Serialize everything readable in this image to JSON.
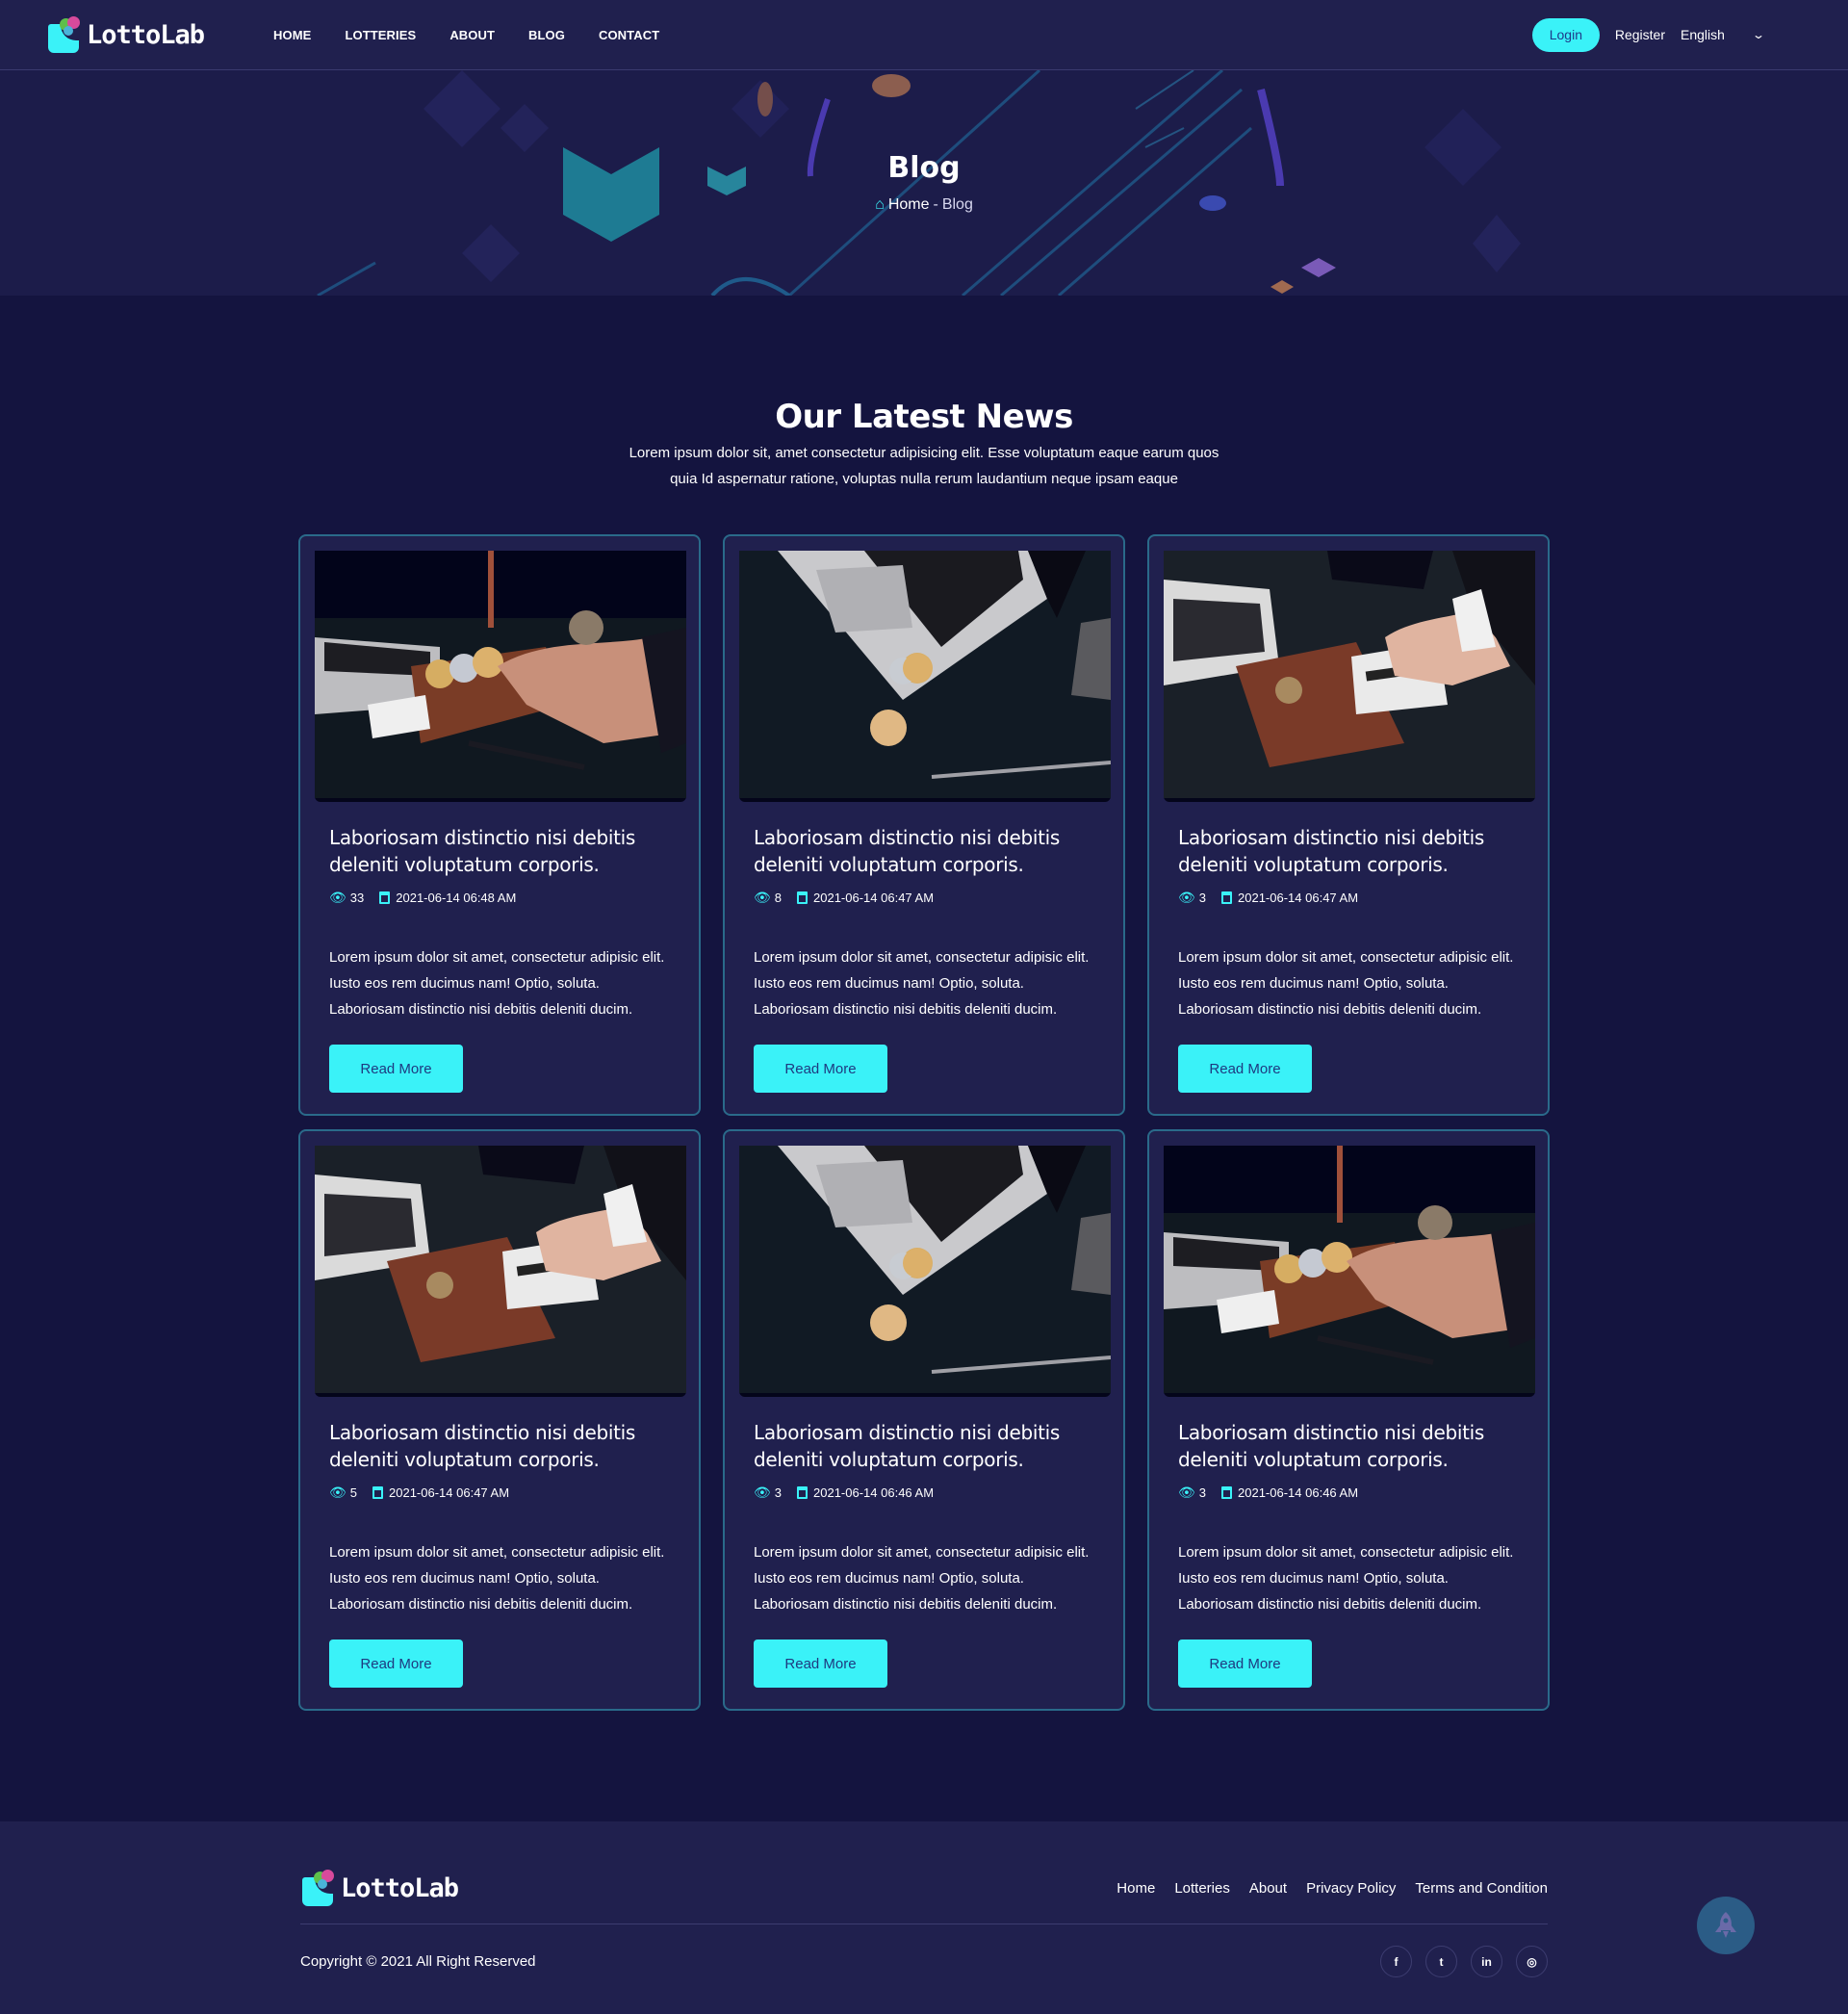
{
  "brand": {
    "name": "LottoLab"
  },
  "nav": {
    "menu": [
      "HOME",
      "LOTTERIES",
      "ABOUT",
      "BLOG",
      "CONTACT"
    ],
    "login": "Login",
    "register": "Register",
    "language": "English"
  },
  "hero": {
    "title": "Blog",
    "breadcrumb": {
      "home": "Home",
      "separator": "-",
      "current": "Blog"
    }
  },
  "section": {
    "title": "Our Latest News",
    "subtitle": "Lorem ipsum dolor sit, amet consectetur adipisicing elit. Esse voluptatum eaque earum quos quia Id aspernatur ratione, voluptas nulla rerum laudantium neque ipsam eaque"
  },
  "posts": [
    {
      "image": "hand-wallet-coins",
      "title": "Laboriosam distinctio nisi debitis deleniti voluptatum corporis.",
      "views": "33",
      "date": "2021-06-14 06:48 AM",
      "excerpt": "Lorem ipsum dolor sit amet, consectetur adipisic elit. Iusto eos rem ducimus nam! Optio, soluta. Laboriosam distinctio nisi debitis deleniti ducim.",
      "button": "Read More"
    },
    {
      "image": "laptop-coins",
      "title": "Laboriosam distinctio nisi debitis deleniti voluptatum corporis.",
      "views": "8",
      "date": "2021-06-14 06:47 AM",
      "excerpt": "Lorem ipsum dolor sit amet, consectetur adipisic elit. Iusto eos rem ducimus nam! Optio, soluta. Laboriosam distinctio nisi debitis deleniti ducim.",
      "button": "Read More"
    },
    {
      "image": "wallet-card",
      "title": "Laboriosam distinctio nisi debitis deleniti voluptatum corporis.",
      "views": "3",
      "date": "2021-06-14 06:47 AM",
      "excerpt": "Lorem ipsum dolor sit amet, consectetur adipisic elit. Iusto eos rem ducimus nam! Optio, soluta. Laboriosam distinctio nisi debitis deleniti ducim.",
      "button": "Read More"
    },
    {
      "image": "wallet-card",
      "title": "Laboriosam distinctio nisi debitis deleniti voluptatum corporis.",
      "views": "5",
      "date": "2021-06-14 06:47 AM",
      "excerpt": "Lorem ipsum dolor sit amet, consectetur adipisic elit. Iusto eos rem ducimus nam! Optio, soluta. Laboriosam distinctio nisi debitis deleniti ducim.",
      "button": "Read More"
    },
    {
      "image": "laptop-coins",
      "title": "Laboriosam distinctio nisi debitis deleniti voluptatum corporis.",
      "views": "3",
      "date": "2021-06-14 06:46 AM",
      "excerpt": "Lorem ipsum dolor sit amet, consectetur adipisic elit. Iusto eos rem ducimus nam! Optio, soluta. Laboriosam distinctio nisi debitis deleniti ducim.",
      "button": "Read More"
    },
    {
      "image": "hand-wallet-coins",
      "title": "Laboriosam distinctio nisi debitis deleniti voluptatum corporis.",
      "views": "3",
      "date": "2021-06-14 06:46 AM",
      "excerpt": "Lorem ipsum dolor sit amet, consectetur adipisic elit. Iusto eos rem ducimus nam! Optio, soluta. Laboriosam distinctio nisi debitis deleniti ducim.",
      "button": "Read More"
    }
  ],
  "footer": {
    "links": [
      "Home",
      "Lotteries",
      "About",
      "Privacy Policy",
      "Terms and Condition"
    ],
    "copyright": "Copyright © 2021 All Right Reserved",
    "socials": [
      {
        "name": "facebook",
        "glyph": "f"
      },
      {
        "name": "twitter",
        "glyph": "t"
      },
      {
        "name": "linkedin",
        "glyph": "in"
      },
      {
        "name": "instagram",
        "glyph": "◎"
      }
    ]
  },
  "colors": {
    "accent": "#3af2f8",
    "nav_bg": "#20204e",
    "page_bg": "#14143f",
    "card_border": "#2a6a8a"
  }
}
